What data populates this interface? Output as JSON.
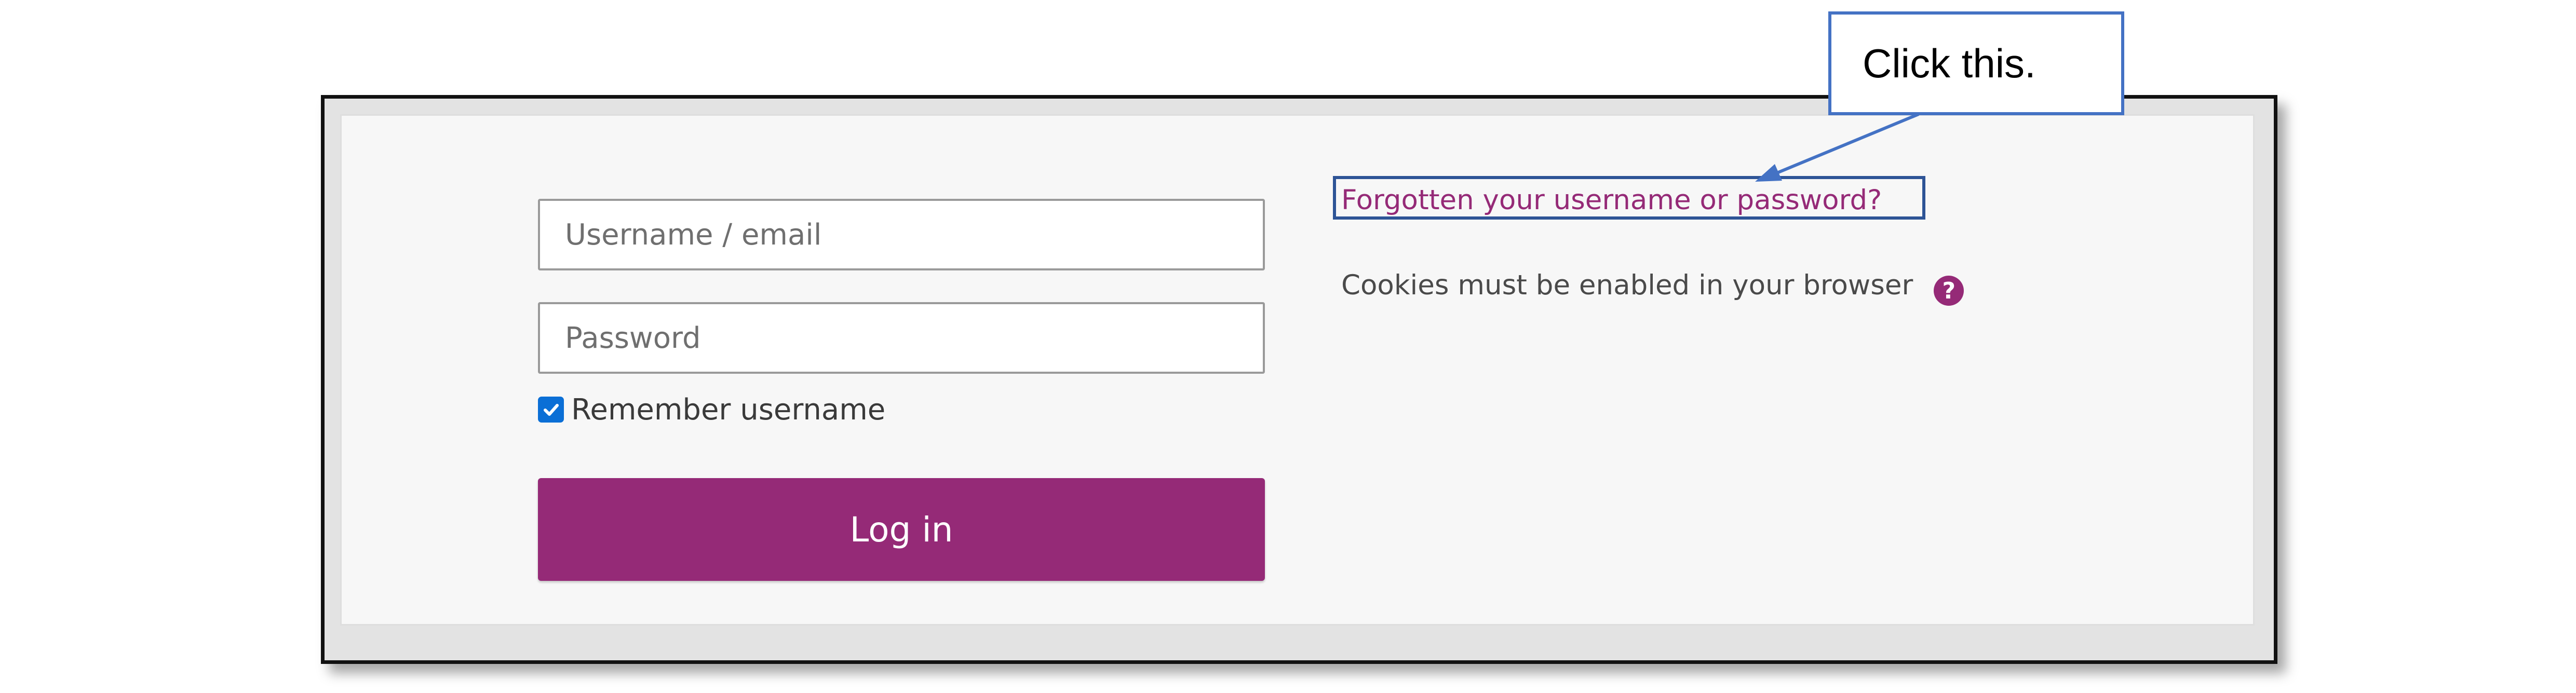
{
  "login_form": {
    "username": {
      "value": "",
      "placeholder": "Username / email"
    },
    "password": {
      "value": "",
      "placeholder": "Password"
    },
    "remember": {
      "label": "Remember username",
      "checked": true
    },
    "login_button_label": "Log in",
    "forgot_link": "Forgotten your username or password?",
    "cookies_notice": "Cookies must be enabled in your browser",
    "help_icon_glyph": "?"
  },
  "annotation": {
    "callout_text": "Click this."
  },
  "colors": {
    "brand": "#952a77",
    "checkbox": "#0b6fd6",
    "annotation_blue": "#4472c4",
    "highlight_border": "#2e5496"
  }
}
